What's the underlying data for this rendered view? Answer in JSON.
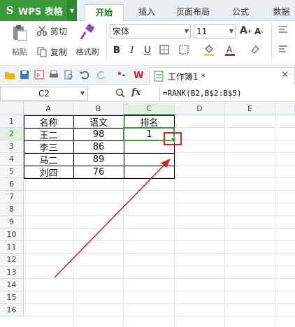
{
  "app": {
    "title": "WPS 表格"
  },
  "ribbon_tabs": [
    "开始",
    "插入",
    "页面布局",
    "公式",
    "数据"
  ],
  "clipboard": {
    "paste": "粘贴",
    "cut": "剪切",
    "copy": "复制",
    "format_painter": "格式刷"
  },
  "font": {
    "name": "宋体",
    "size": "11"
  },
  "document": {
    "tab_title": "工作簿1 *"
  },
  "formula_bar": {
    "cell_ref": "C2",
    "fx": "fx",
    "formula": "=RANK(B2,B$2:B$5)"
  },
  "sheet": {
    "columns": [
      "A",
      "B",
      "C",
      "D",
      "E"
    ],
    "rows": [
      "1",
      "2",
      "3",
      "4",
      "5",
      "6",
      "7",
      "8",
      "9",
      "10",
      "11",
      "12",
      "13",
      "14",
      "15",
      "16"
    ],
    "cells": {
      "A1": "名称",
      "B1": "语文",
      "C1": "排名",
      "A2": "王二",
      "B2": "98",
      "C2": "1",
      "A3": "李三",
      "B3": "86",
      "A4": "马二",
      "B4": "89",
      "A5": "刘四",
      "B5": "76"
    }
  },
  "colors": {
    "accent": "#3a9a3a",
    "annotation": "#e02020"
  }
}
